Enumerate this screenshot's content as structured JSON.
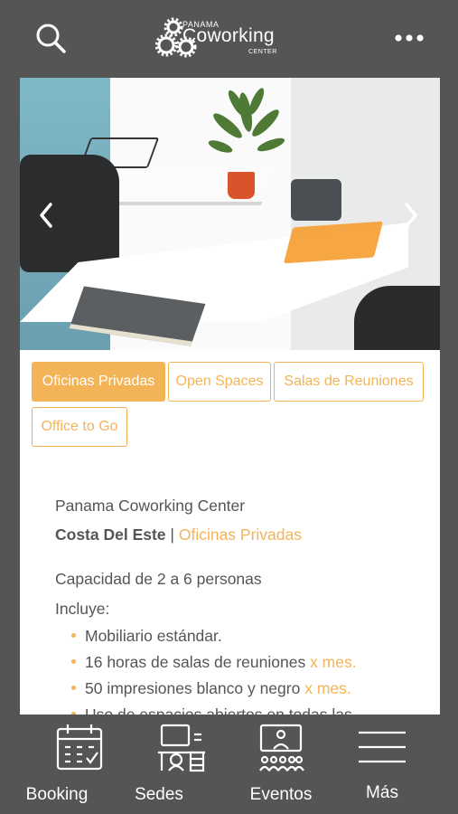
{
  "header": {
    "logo_top": "PANAMA",
    "logo_main": "Coworking",
    "logo_sub": "CENTER",
    "search_icon": "search-icon",
    "more_icon": "more-horizontal-icon"
  },
  "carousel": {
    "prev_icon": "chevron-left-icon",
    "next_icon": "chevron-right-icon"
  },
  "tabs": [
    {
      "label": "Oficinas Privadas",
      "active": true
    },
    {
      "label": "Open Spaces",
      "active": false
    },
    {
      "label": "Salas de Reuniones",
      "active": false
    },
    {
      "label": "Office to Go",
      "active": false
    }
  ],
  "content": {
    "company": "Panama Coworking Center",
    "location": "Costa Del Este",
    "separator": "|",
    "category": "Oficinas Privadas",
    "capacity": "Capacidad de 2 a 6 personas",
    "includes_label": "Incluye:",
    "bullets": [
      {
        "text": "Mobiliario estándar.",
        "highlight": ""
      },
      {
        "text": "16 horas de salas de reuniones ",
        "highlight": "x mes."
      },
      {
        "text": "50 impresiones blanco y negro ",
        "highlight": "x mes."
      },
      {
        "text": "Uso de espacios abiertos en todas las",
        "highlight": ""
      }
    ]
  },
  "bottom_nav": [
    {
      "label": "Booking",
      "icon": "calendar-icon"
    },
    {
      "label": "Sedes",
      "icon": "office-desk-icon"
    },
    {
      "label": "Eventos",
      "icon": "presentation-icon"
    },
    {
      "label": "Más",
      "icon": "menu-icon"
    }
  ],
  "colors": {
    "accent": "#f3b457",
    "chrome": "#555555",
    "text": "#555555"
  }
}
